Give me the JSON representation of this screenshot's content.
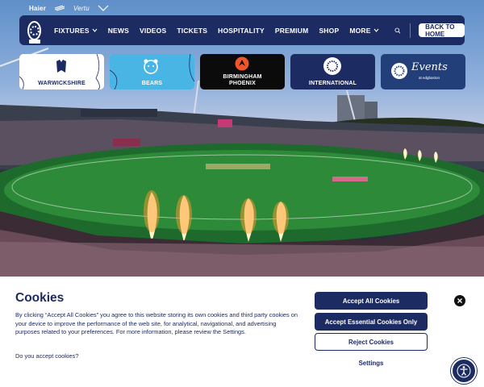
{
  "sponsors": [
    "Haier",
    "Vertu"
  ],
  "nav": {
    "items": [
      {
        "label": "FIXTURES",
        "dropdown": true
      },
      {
        "label": "NEWS",
        "dropdown": false
      },
      {
        "label": "VIDEOS",
        "dropdown": false
      },
      {
        "label": "TICKETS",
        "dropdown": false
      },
      {
        "label": "HOSPITALITY",
        "dropdown": false
      },
      {
        "label": "PREMIUM",
        "dropdown": false
      },
      {
        "label": "SHOP",
        "dropdown": false
      },
      {
        "label": "MORE",
        "dropdown": true
      }
    ],
    "back_button": "BACK TO HOME",
    "search_icon": "search-icon"
  },
  "tiles": [
    {
      "label": "WARWICKSHIRE",
      "icon": "bear-crest-icon"
    },
    {
      "label": "BEARS",
      "icon": "bear-head-icon"
    },
    {
      "label_line1": "BIRMINGHAM",
      "label_line2": "PHOENIX",
      "icon": "phoenix-icon"
    },
    {
      "label": "INTERNATIONAL",
      "icon": "edgbaston-badge-icon"
    },
    {
      "script": "Events",
      "sub": "at edgbaston",
      "icon": "edgbaston-badge-icon"
    }
  ],
  "cookie": {
    "title": "Cookies",
    "body": "By clicking “Accept All Cookies” you agree to this website storing its own cookies and third party cookies on your device to improve the performance of the web site, for analytical, navigational, and advertising purposes related to your preferences. For more information, please review the Settings.",
    "question": "Do you accept cookies?",
    "accept_all": "Accept All Cookies",
    "accept_essential": "Accept Essential Cookies Only",
    "reject": "Reject Cookies",
    "settings": "Settings"
  },
  "colors": {
    "navy": "#1d2b63",
    "bears_blue": "#48b5e5",
    "phoenix_orange": "#f0562a",
    "white": "#ffffff"
  }
}
